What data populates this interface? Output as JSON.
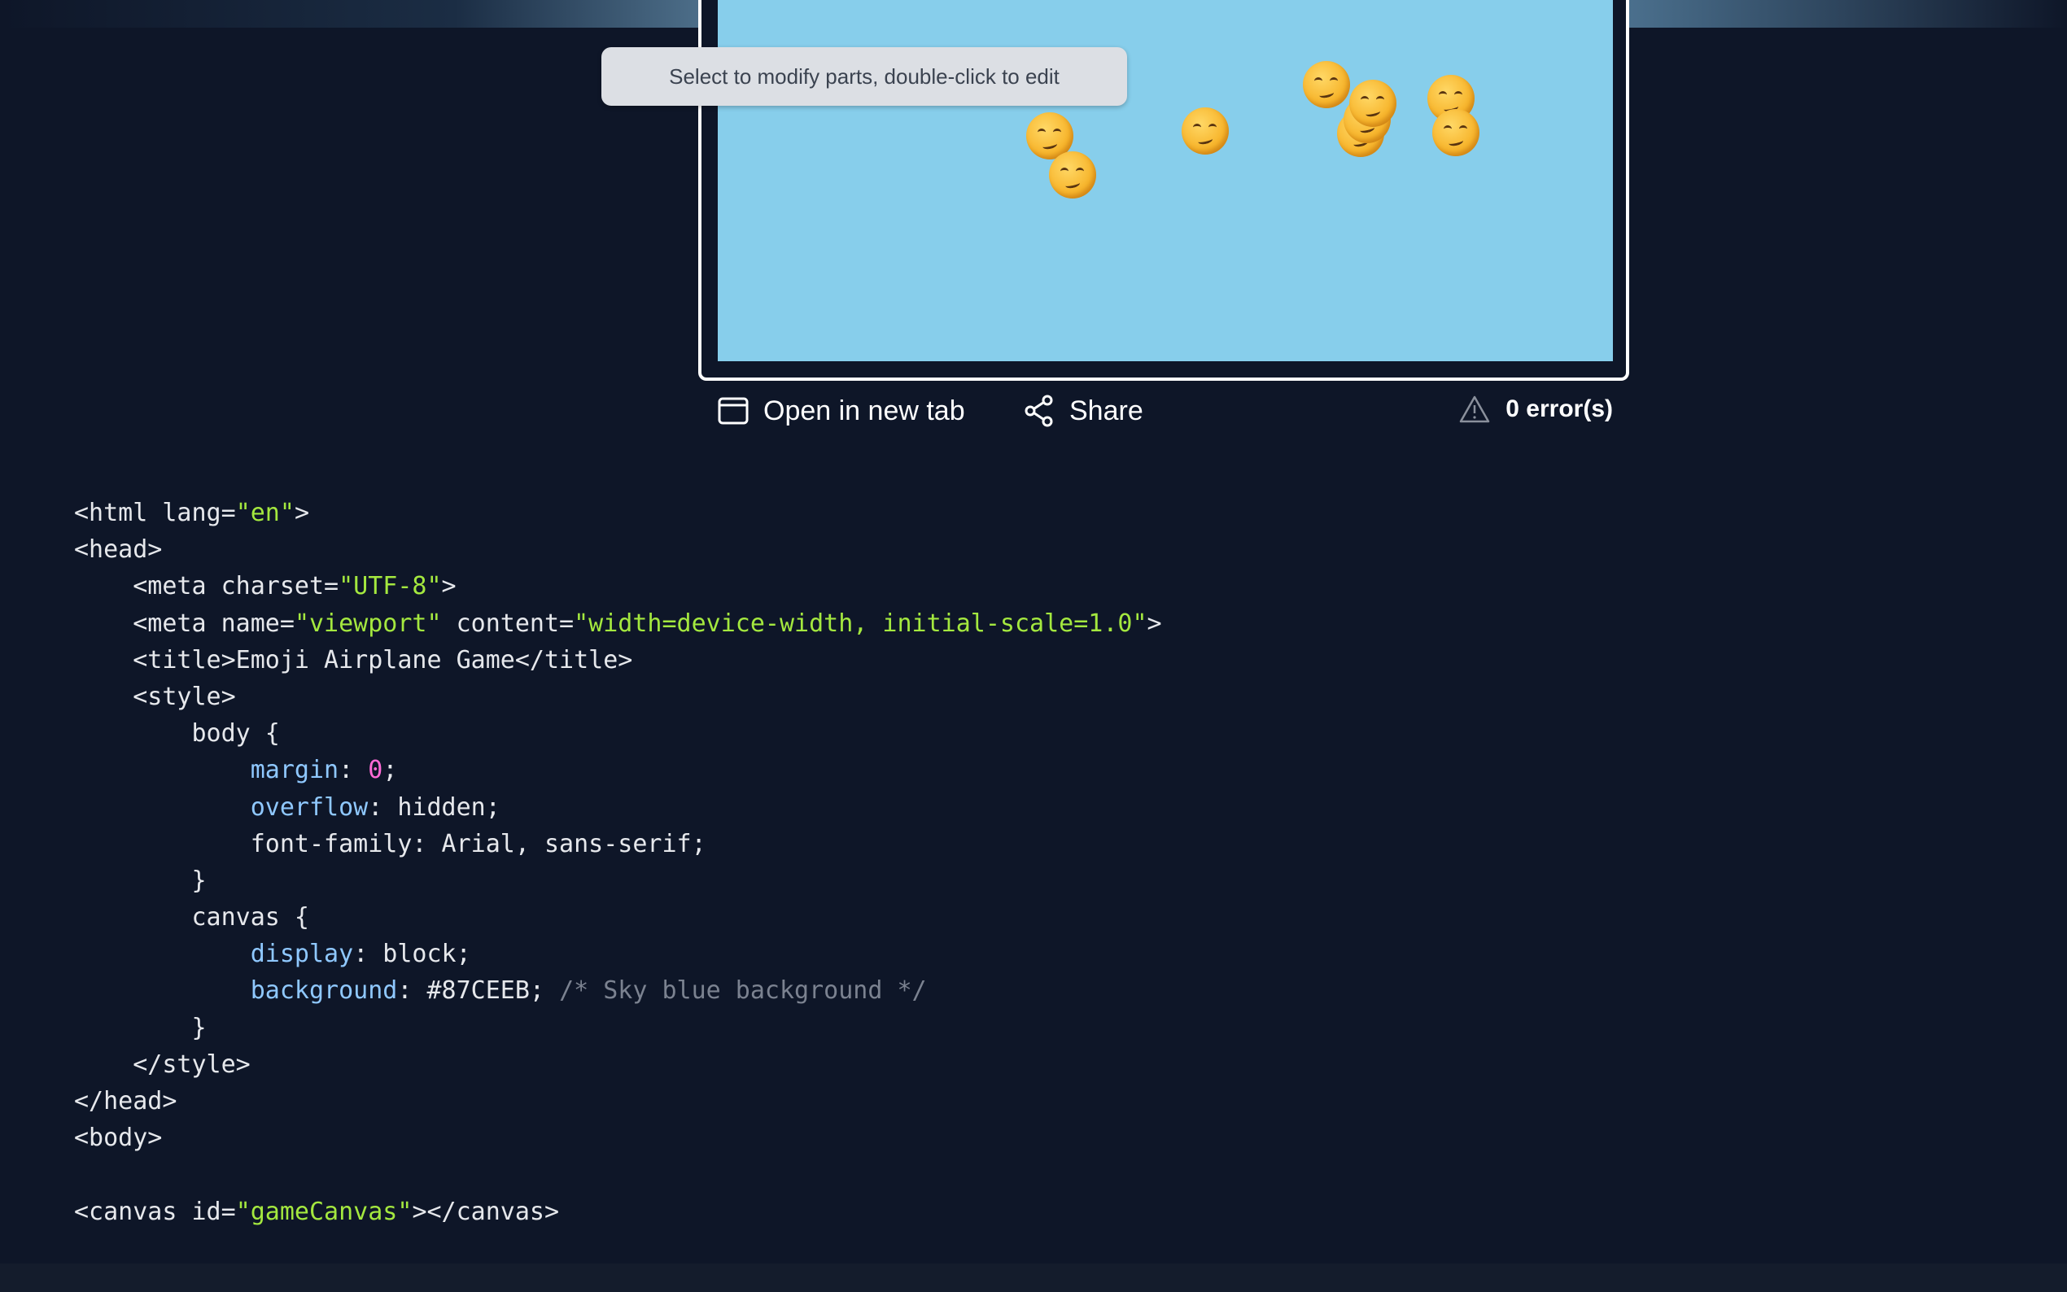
{
  "preview": {
    "tooltip": "Select to modify parts, double-click to edit",
    "background_color": "#87CEEB",
    "emoji_icon": "face-with-tear-emoji"
  },
  "toolbar": {
    "open_label": "Open in new tab",
    "share_label": "Share",
    "errors_label": "0 error(s)"
  },
  "code": {
    "l1": {
      "a": "<html lang=",
      "b": "\"en\"",
      "c": ">"
    },
    "l2": {
      "a": "<head>"
    },
    "l3": {
      "a": "    <meta charset=",
      "b": "\"UTF-8\"",
      "c": ">"
    },
    "l4": {
      "a": "    <meta name=",
      "b": "\"viewport\"",
      "c": " content=",
      "d": "\"width=device-width, initial-scale=1.0\"",
      "e": ">"
    },
    "l5": {
      "a": "    <title>Emoji Airplane Game</title>"
    },
    "l6": {
      "a": "    <style>"
    },
    "l7": {
      "a": "        body {"
    },
    "l8": {
      "a": "            ",
      "b": "margin",
      "c": ": ",
      "d": "0",
      "e": ";"
    },
    "l9": {
      "a": "            ",
      "b": "overflow",
      "c": ": hidden;"
    },
    "l10": {
      "a": "            font-family: Arial, sans-serif;"
    },
    "l11": {
      "a": "        }"
    },
    "l12": {
      "a": "        canvas {"
    },
    "l13": {
      "a": "            ",
      "b": "display",
      "c": ": block;"
    },
    "l14": {
      "a": "            ",
      "b": "background",
      "c": ": #87CEEB; ",
      "d": "/* Sky blue background */"
    },
    "l15": {
      "a": "        }"
    },
    "l16": {
      "a": "    </style>"
    },
    "l17": {
      "a": "</head>"
    },
    "l18": {
      "a": "<body>"
    },
    "l19": {
      "a": ""
    },
    "l20": {
      "a": "<canvas id=",
      "b": "\"gameCanvas\"",
      "c": "></canvas>"
    }
  }
}
